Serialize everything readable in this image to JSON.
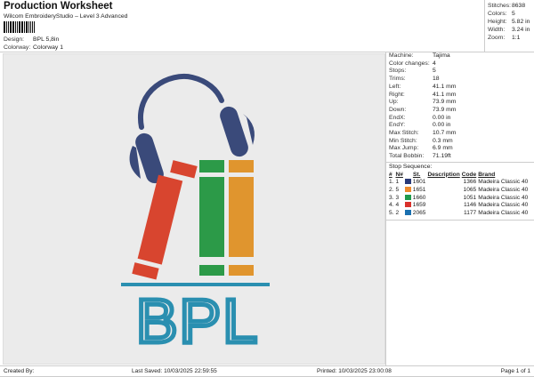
{
  "header": {
    "title": "Production Worksheet",
    "subtitle": "Wilcom EmbroideryStudio – Level 3 Advanced",
    "design_label": "Design:",
    "design_value": "BPL 5,8in",
    "colorway_label": "Colorway:",
    "colorway_value": "Colorway 1"
  },
  "stats": [
    {
      "k": "Stitches:",
      "v": "8638"
    },
    {
      "k": "Colors:",
      "v": "5"
    },
    {
      "k": "Height:",
      "v": "5.82 in"
    },
    {
      "k": "Width:",
      "v": "3.24 in"
    },
    {
      "k": "Zoom:",
      "v": "1:1"
    }
  ],
  "machine": [
    {
      "k": "Machine:",
      "v": "Tajima"
    },
    {
      "k": "Color changes:",
      "v": "4"
    },
    {
      "k": "Stops:",
      "v": "5"
    },
    {
      "k": "Trims:",
      "v": "18"
    },
    {
      "k": "Left:",
      "v": "41.1 mm"
    },
    {
      "k": "Right:",
      "v": "41.1 mm"
    },
    {
      "k": "Up:",
      "v": "73.9 mm"
    },
    {
      "k": "Down:",
      "v": "73.9 mm"
    },
    {
      "k": "EndX:",
      "v": "0.00 in"
    },
    {
      "k": "EndY:",
      "v": "0.00 in"
    },
    {
      "k": "Max Stitch:",
      "v": "10.7 mm"
    },
    {
      "k": "Min Stitch:",
      "v": "0.3 mm"
    },
    {
      "k": "Max Jump:",
      "v": "6.9 mm"
    },
    {
      "k": "Total Bobbin:",
      "v": "71.19ft"
    }
  ],
  "stop_sequence": {
    "title": "Stop Sequence:",
    "headers": [
      "#",
      "N#",
      "St.",
      "Description",
      "Code",
      "Brand"
    ],
    "rows": [
      {
        "num": "1.",
        "n": "1",
        "color": "#2a3a78",
        "st": "1601",
        "code": "1366",
        "brand": "Madeira Classic 40"
      },
      {
        "num": "2.",
        "n": "5",
        "color": "#ef8a2c",
        "st": "1651",
        "code": "1065",
        "brand": "Madeira Classic 40"
      },
      {
        "num": "3.",
        "n": "3",
        "color": "#1f9a4c",
        "st": "1660",
        "code": "1051",
        "brand": "Madeira Classic 40"
      },
      {
        "num": "4.",
        "n": "4",
        "color": "#d9312b",
        "st": "1659",
        "code": "1146",
        "brand": "Madeira Classic 40"
      },
      {
        "num": "5.",
        "n": "2",
        "color": "#1a70b0",
        "st": "2065",
        "code": "1177",
        "brand": "Madeira Classic 40"
      }
    ]
  },
  "design": {
    "text": "BPL",
    "colors": {
      "headphones": "#3a4a7a",
      "red": "#d8452f",
      "green": "#2c9a48",
      "orange": "#e0952e",
      "teal": "#2a8fb0"
    }
  },
  "footer": {
    "created": "Created By:",
    "saved": "Last Saved: 10/03/2025 22:59:55",
    "printed": "Printed: 10/03/2025 23:00:08",
    "page": "Page 1 of 1"
  }
}
